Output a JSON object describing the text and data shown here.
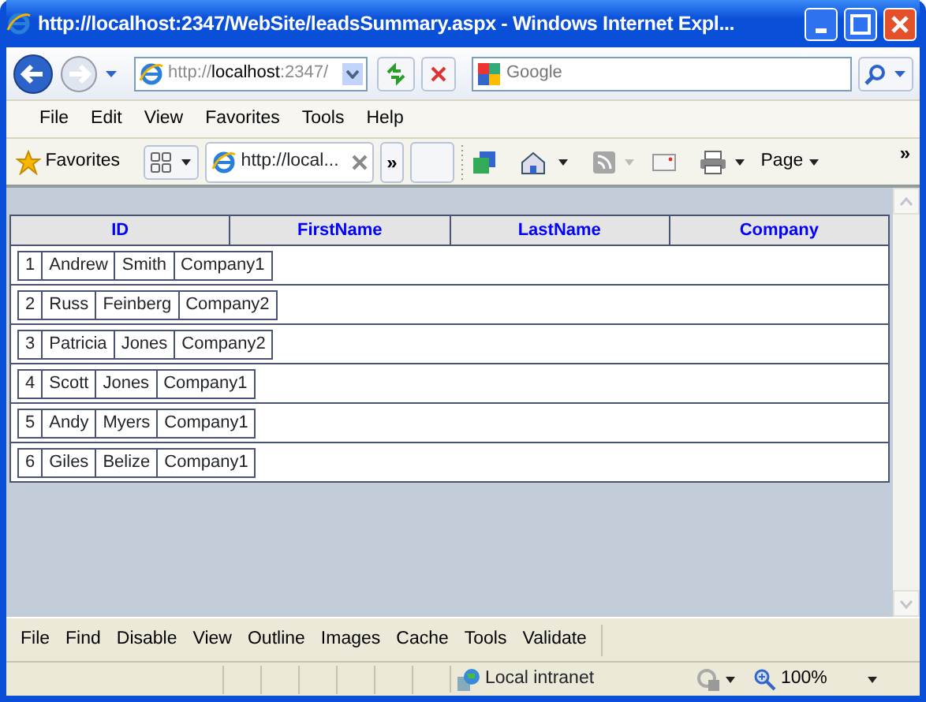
{
  "window": {
    "title": "http://localhost:2347/WebSite/leadsSummary.aspx - Windows Internet Expl..."
  },
  "address": {
    "segments": [
      {
        "text": "http://",
        "kind": "dim"
      },
      {
        "text": "localhost",
        "kind": "main"
      },
      {
        "text": ":2347/",
        "kind": "dim"
      }
    ]
  },
  "search": {
    "placeholder": "Google"
  },
  "menu": [
    "File",
    "Edit",
    "View",
    "Favorites",
    "Tools",
    "Help"
  ],
  "favorites_bar": {
    "favorites": "Favorites",
    "tab_title": "http://local...",
    "more_tabs": "»",
    "page_menu": "Page",
    "overflow": "»"
  },
  "grid_view": {
    "header_labels": [
      "ID",
      "FirstName",
      "LastName",
      "Company"
    ],
    "records": [
      [
        "1",
        "Andrew",
        "Smith",
        "Company1"
      ],
      [
        "2",
        "Russ",
        "Feinberg",
        "Company2"
      ],
      [
        "3",
        "Patricia",
        "Jones",
        "Company2"
      ],
      [
        "4",
        "Scott",
        "Jones",
        "Company1"
      ],
      [
        "5",
        "Andy",
        "Myers",
        "Company1"
      ],
      [
        "6",
        "Giles",
        "Belize",
        "Company1"
      ]
    ]
  },
  "dev_toolbar": [
    "File",
    "Find",
    "Disable",
    "View",
    "Outline",
    "Images",
    "Cache",
    "Tools",
    "Validate"
  ],
  "status_bar": {
    "zone": "Local intranet",
    "zoom": "100%"
  }
}
